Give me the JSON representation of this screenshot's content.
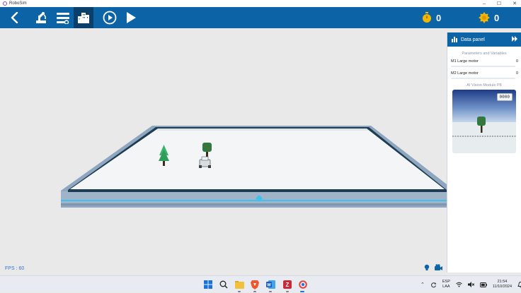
{
  "window": {
    "title": "RoboSim",
    "controls": [
      "–",
      "☐",
      "✕"
    ]
  },
  "toolbar": {
    "buttons": [
      {
        "name": "back-icon"
      },
      {
        "name": "robot-arm-icon"
      },
      {
        "name": "settings-sliders-icon"
      },
      {
        "name": "city-icon",
        "active": true
      },
      {
        "name": "play-circle-icon"
      },
      {
        "name": "play-icon"
      }
    ],
    "timer_value": "0",
    "score_value": "0"
  },
  "scene": {
    "fps_text": "FPS : 60"
  },
  "data_panel": {
    "title": "Data panel",
    "params_label": "Parameters and Variables",
    "params": [
      {
        "label": "M1 Large motor",
        "value": "0"
      },
      {
        "label": "M2 Large motor",
        "value": "0"
      }
    ],
    "vision_label": "AI Vision Module P8",
    "vision_readout": "0000"
  },
  "taskbar": {
    "lang": "ESP",
    "lang_sub": "LAA",
    "time": "21:54",
    "date": "11/10/2024"
  },
  "colors": {
    "toolbar": "#0c63a6",
    "active": "#0a3f6b",
    "accent": "#2e7ad1"
  }
}
